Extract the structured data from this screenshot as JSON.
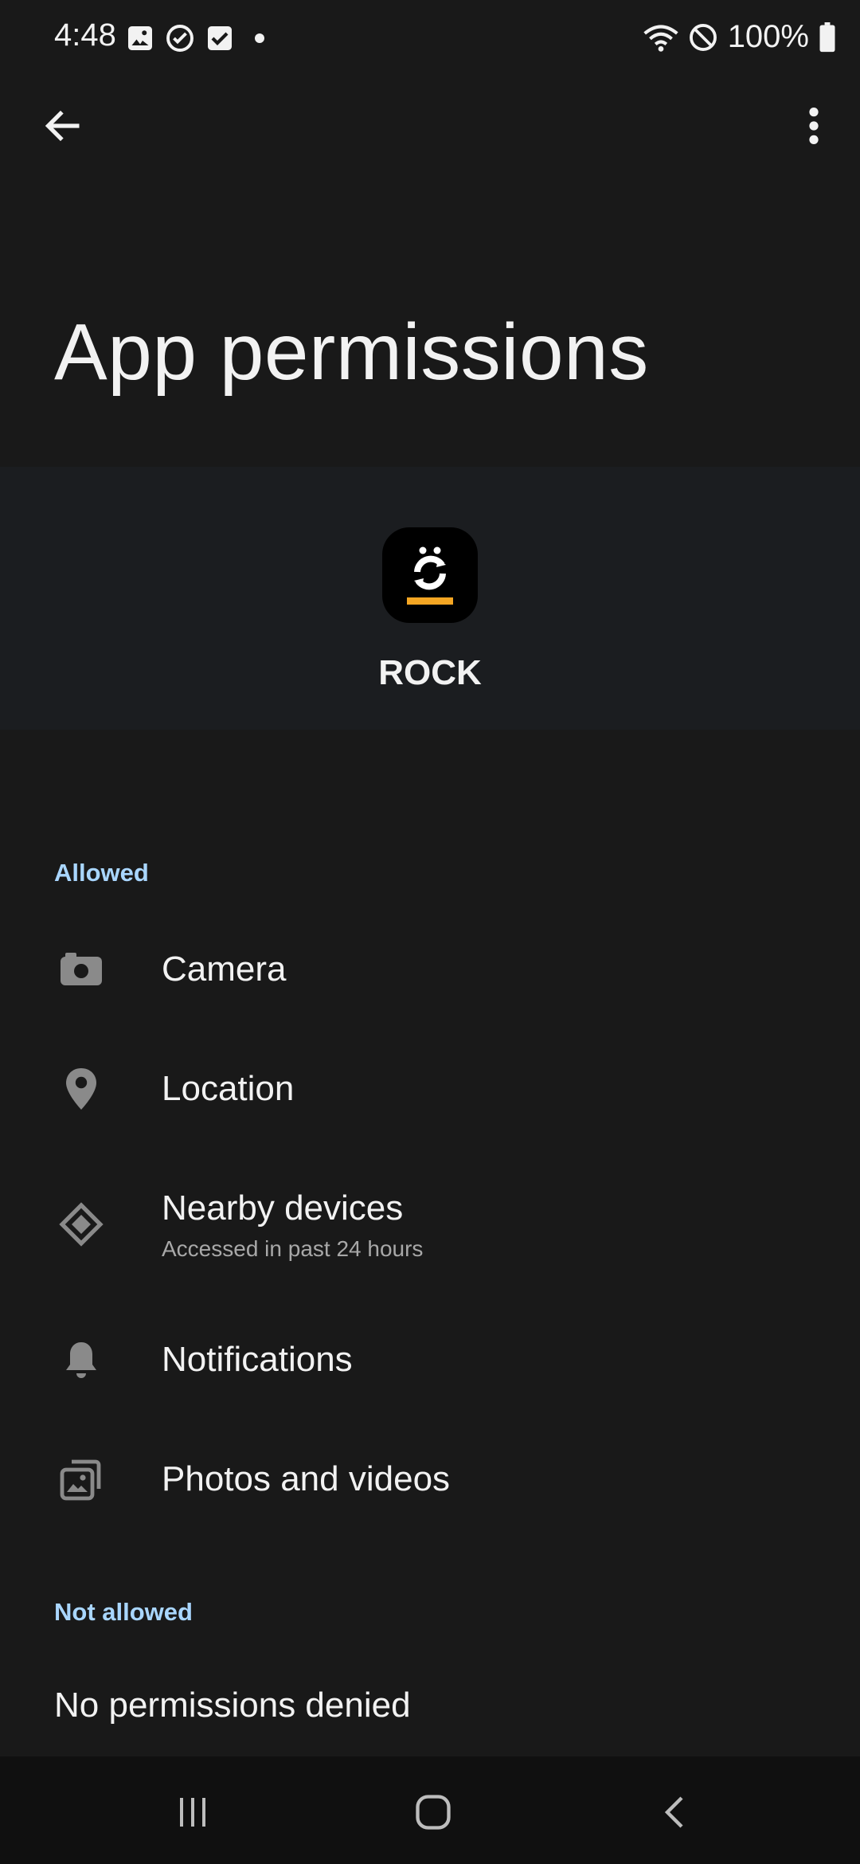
{
  "status_bar": {
    "time": "4:48",
    "battery": "100%",
    "left_icons": [
      "image-icon",
      "sync-icon",
      "checkbox-icon",
      "dot-icon"
    ],
    "right_icons": [
      "wifi-icon",
      "do-not-disturb-icon",
      "battery-icon"
    ]
  },
  "app_bar": {
    "back_icon": "arrow-left-icon",
    "more_icon": "more-vert-icon"
  },
  "page": {
    "title": "App permissions"
  },
  "app": {
    "name": "ROCK",
    "accent": "#f5a623"
  },
  "sections": {
    "allowed_label": "Allowed",
    "not_allowed_label": "Not allowed",
    "no_denied": "No permissions denied"
  },
  "permissions": [
    {
      "label": "Camera",
      "icon": "camera-icon"
    },
    {
      "label": "Location",
      "icon": "location-pin-icon"
    },
    {
      "label": "Nearby devices",
      "sublabel": "Accessed in past 24 hours",
      "icon": "nearby-devices-icon"
    },
    {
      "label": "Notifications",
      "icon": "bell-icon"
    },
    {
      "label": "Photos and videos",
      "icon": "photos-icon"
    }
  ],
  "nav": {
    "recents_icon": "recents-icon",
    "home_icon": "home-icon",
    "back_icon": "nav-back-icon"
  },
  "colors": {
    "background": "#191919",
    "header_band": "#1b1d20",
    "section_label": "#a9d6ff",
    "icon_gray": "#8a8a8a"
  }
}
